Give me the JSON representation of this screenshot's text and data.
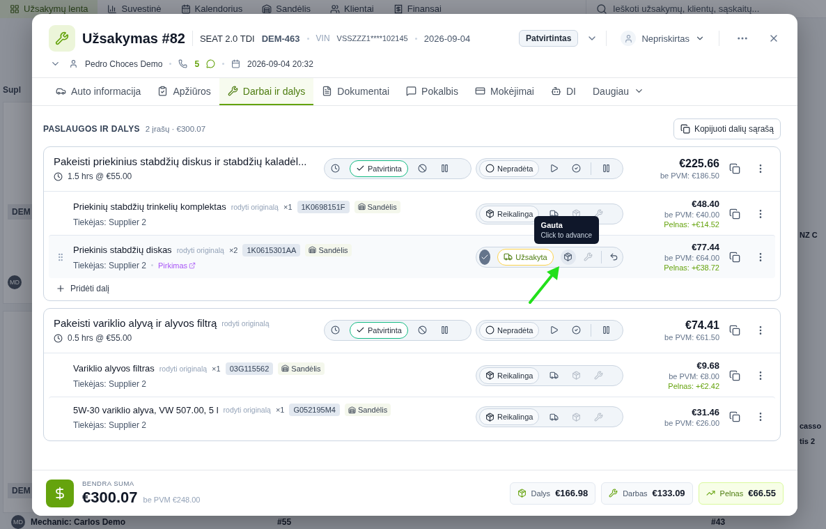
{
  "nav": {
    "items": [
      {
        "label": "Užsakymų lenta",
        "selected": true
      },
      {
        "label": "Suvestinė",
        "selected": false
      },
      {
        "label": "Kalendorius",
        "selected": false
      },
      {
        "label": "Sandėlis",
        "selected": false
      },
      {
        "label": "Klientai",
        "selected": false
      },
      {
        "label": "Finansai",
        "selected": false
      }
    ],
    "search": {
      "placeholder": "Ieškoti užsakymų, klientų, sąskaitų..."
    }
  },
  "board": {
    "toolbar_label": "Supl",
    "left_tags": [
      "DEM",
      "DEM"
    ],
    "left_avatar": "MD",
    "right_fragments": [
      "NZ C",
      "casso",
      "tis 2"
    ],
    "bottom": {
      "avatar": "MD",
      "mechanic": "Mechanic: Carlos Demo",
      "card_a": "#55",
      "card_b": "#43"
    }
  },
  "order": {
    "title": "Užsakymas #82",
    "car": "SEAT 2.0 TDI",
    "plate": "DEM-463",
    "vin_label": "VIN",
    "vin": "VSSZZZ1****102145",
    "date": "2026-09-04",
    "status": "Patvirtintas",
    "assignee": "Nepriskirtas",
    "customer": "Pedro Choces Demo",
    "calls": "5",
    "created": "2026-09-04 20:32"
  },
  "tabs": [
    {
      "label": "Auto informacija",
      "selected": false
    },
    {
      "label": "Apžiūros",
      "selected": false
    },
    {
      "label": "Darbai ir dalys",
      "selected": true
    },
    {
      "label": "Dokumentai",
      "selected": false
    },
    {
      "label": "Pokalbis",
      "selected": false
    },
    {
      "label": "Mokėjimai",
      "selected": false
    },
    {
      "label": "DI",
      "selected": false
    },
    {
      "label": "Daugiau",
      "selected": false
    }
  ],
  "section": {
    "title": "PASLAUGOS IR DALYS",
    "summary": "2 įrašų · €300.07",
    "copy_button": "Kopijuoti dalių sąrašą"
  },
  "services": [
    {
      "title": "Pakeisti priekinius stabdžių diskus ir stabdžių kaladėl...",
      "hours": "1.5 hrs @ €55.00",
      "approval": "Patvirtinta",
      "progress": "Nepradėta",
      "started": false,
      "price": "€225.66",
      "net": "be PVM: €186.50",
      "add_part": "Pridėti dalį",
      "parts": [
        {
          "name": "Priekinių stabdžių trinkelių komplektas",
          "original_link": "rodyti originalą",
          "qty": "×1",
          "code": "1K0698151F",
          "stock": "Sandėlis",
          "supplier": "Tiekėjas: Supplier 2",
          "status": {
            "kind": "required",
            "label": "Reikalinga"
          },
          "price": "€48.40",
          "net": "be PVM: €40.00",
          "profit": "Pelnas: +€14.52",
          "highlighted": false
        },
        {
          "name": "Priekinis stabdžių diskas",
          "original_link": "rodyti originalą",
          "qty": "×2",
          "code": "1K0615301AA",
          "stock": "Sandėlis",
          "supplier": "Tiekėjas: Supplier 2",
          "purchase_link": "Pirkimas",
          "status": {
            "kind": "ordered",
            "label": "Užsakyta"
          },
          "price": "€77.44",
          "net": "be PVM: €64.00",
          "profit": "Pelnas: +€38.72",
          "highlighted": true,
          "tooltip": {
            "title": "Gauta",
            "subtitle": "Click to advance"
          }
        }
      ]
    },
    {
      "title": "Pakeisti variklio alyvą ir alyvos filtrą",
      "original_link": "rodyti originalą",
      "hours": "0.5 hrs @ €55.00",
      "approval": "Patvirtinta",
      "progress": "Nepradėta",
      "started": false,
      "price": "€74.41",
      "net": "be PVM: €61.50",
      "parts": [
        {
          "name": "Variklio alyvos filtras",
          "original_link": "rodyti originalą",
          "qty": "×1",
          "code": "03G115562",
          "stock": "Sandėlis",
          "supplier": "Tiekėjas: Supplier 2",
          "status": {
            "kind": "required",
            "label": "Reikalinga"
          },
          "price": "€9.68",
          "net": "be PVM: €8.00",
          "profit": "Pelnas: +€2.42",
          "highlighted": false
        },
        {
          "name": "5W-30 variklio alyva, VW 507.00, 5 l",
          "original_link": "rodyti originalą",
          "qty": "×1",
          "code": "G052195M4",
          "stock": "Sandėlis",
          "supplier": "Tiekėjas: Supplier 2",
          "status": {
            "kind": "required",
            "label": "Reikalinga"
          },
          "price": "€31.46",
          "net": "be PVM: €26.00",
          "highlighted": false
        }
      ]
    }
  ],
  "footer": {
    "label": "BENDRA SUMA",
    "total": "€300.07",
    "net": "be PVM €248.00",
    "chips": [
      {
        "kind": "parts",
        "label": "Dalys",
        "value": "€166.98"
      },
      {
        "kind": "labor",
        "label": "Darbas",
        "value": "€133.09"
      },
      {
        "kind": "profit",
        "label": "Pelnas",
        "value": "€66.55"
      }
    ]
  }
}
